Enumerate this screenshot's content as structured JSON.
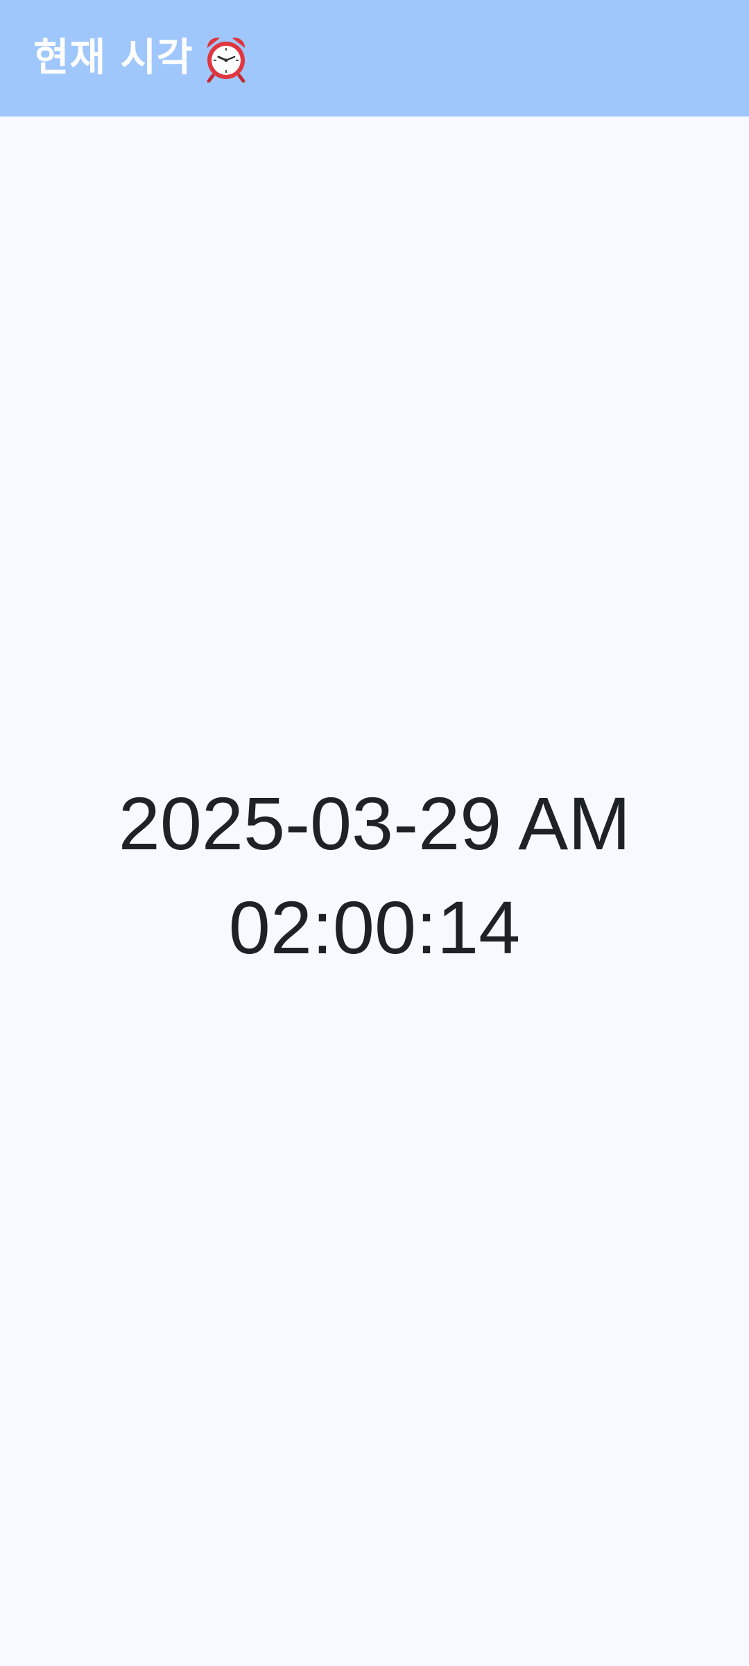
{
  "app_bar": {
    "title": "현재 시각",
    "icon": "alarm-clock-icon",
    "background_color": "#9fc7fb",
    "title_color": "#ffffff"
  },
  "clock": {
    "date_line": "2025-03-29 AM",
    "time_line": "02:00:14",
    "text_color": "#1e2126"
  },
  "page": {
    "background_color": "#f7f9fe"
  }
}
